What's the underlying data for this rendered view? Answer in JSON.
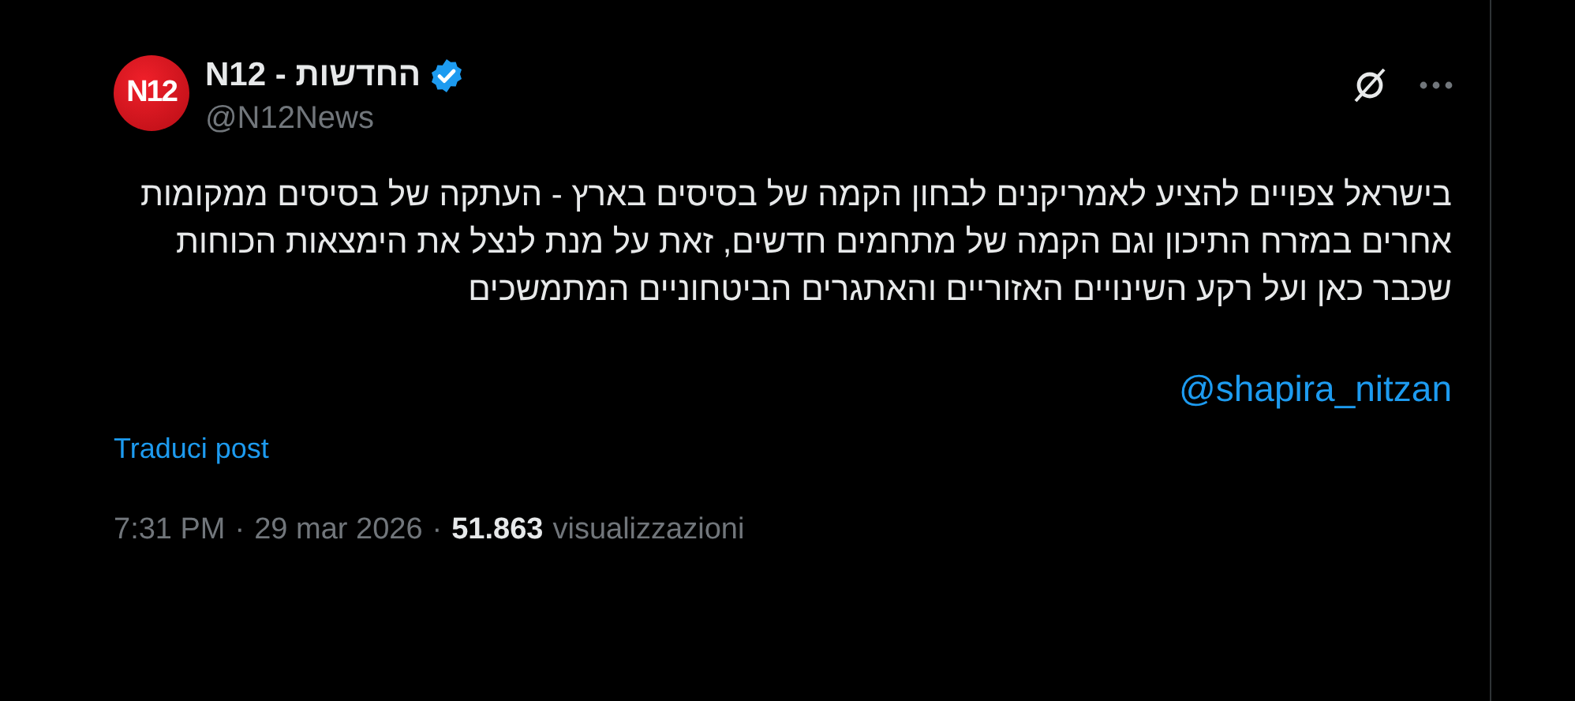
{
  "post": {
    "author": {
      "avatar_text": "N12",
      "name": "N12 - החדשות",
      "verified": true,
      "handle": "@N12News"
    },
    "text": "בישראל צפויים להציע לאמריקנים לבחון הקמה של בסיסים בארץ - העתקה של בסיסים ממקומות אחרים במזרח התיכון וגם הקמה של מתחמים חדשים, זאת על מנת לנצל את הימצאות הכוחות שכבר כאן ועל רקע השינויים האזוריים והאתגרים הביטחוניים המתמשכים",
    "mention": "@shapira_nitzan",
    "translate_link": "Traduci post",
    "time": "7:31 PM",
    "separator_1": "·",
    "date": "29 mar 2026",
    "separator_2": "·",
    "views_count": "51.863",
    "views_label": "visualizzazioni"
  }
}
